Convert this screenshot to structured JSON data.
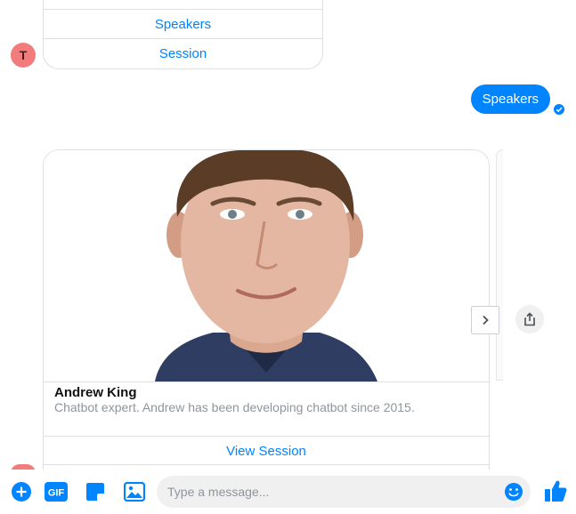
{
  "previous_card": {
    "buttons": [
      "Speakers",
      "Session"
    ],
    "avatar_letter": "T"
  },
  "outgoing": {
    "message": "Speakers"
  },
  "speaker_card": {
    "name": "Andrew King",
    "description": "Chatbot expert. Andrew has been developing chatbot since 2015.",
    "button": "View Session"
  },
  "composer": {
    "placeholder": "Type a message...",
    "gif_label": "GIF"
  },
  "colors": {
    "accent": "#0084ff",
    "avatar": "#f27c7c",
    "divider": "#dddfe2"
  },
  "icons": [
    "plus-icon",
    "gif-icon",
    "sticker-icon",
    "photo-icon",
    "emoji-icon",
    "thumbs-up-icon",
    "chevron-right-icon",
    "share-icon",
    "read-check-icon"
  ]
}
